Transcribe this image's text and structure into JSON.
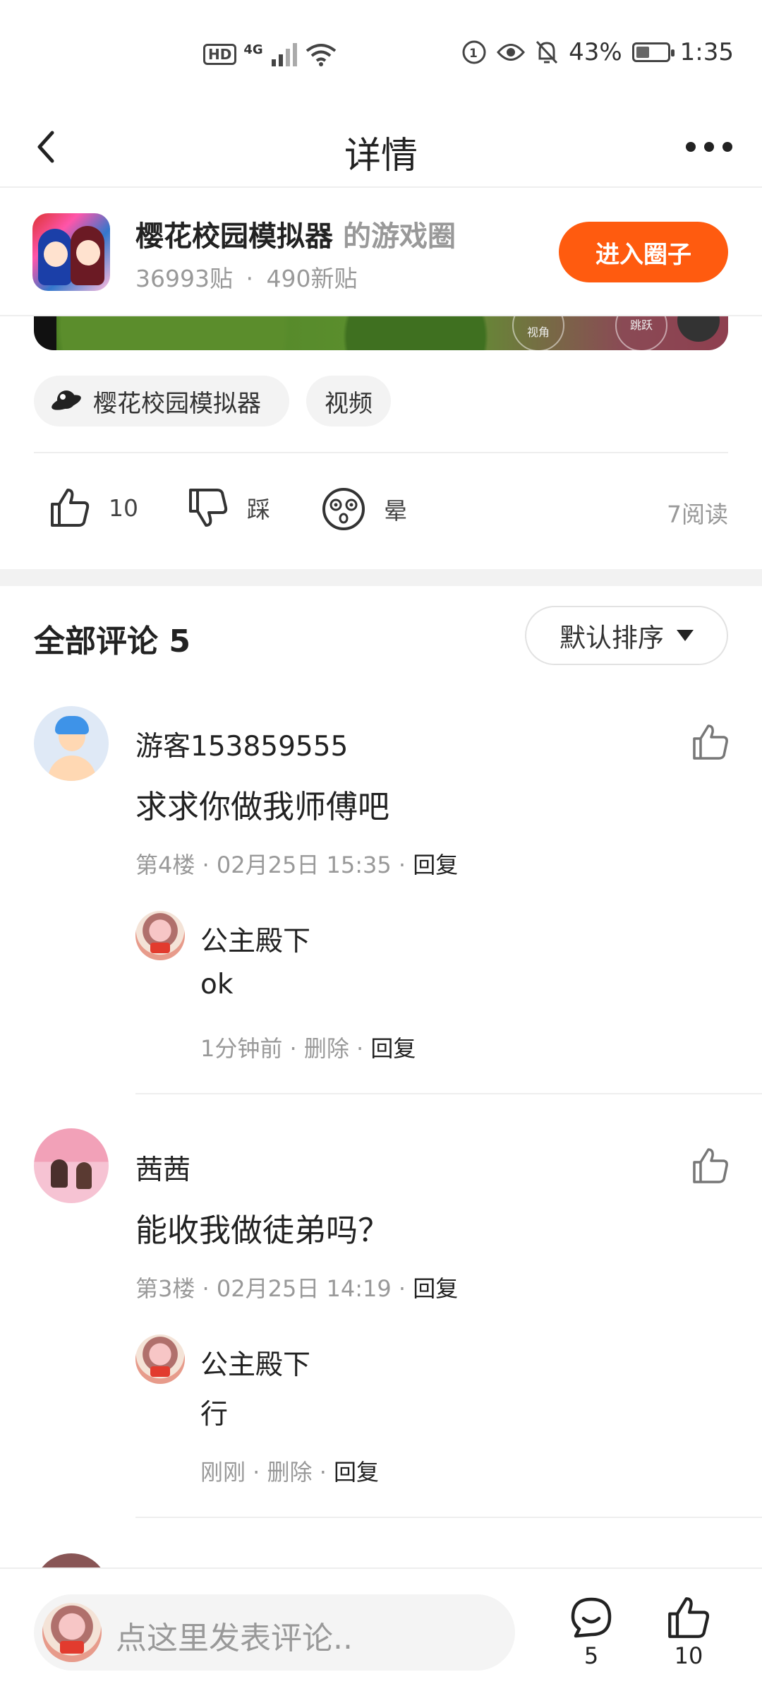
{
  "status_bar": {
    "network": "4G",
    "hd": "HD",
    "battery_percent": "43%",
    "battery_level": 0.43,
    "time": "1:35"
  },
  "header": {
    "title": "详情"
  },
  "circle": {
    "game_name": "樱花校园模拟器",
    "suffix": "的游戏圈",
    "posts": "36993贴",
    "separator": "·",
    "new_posts": "490新贴",
    "enter_label": "进入圈子"
  },
  "video_controls": {
    "c1": "视角",
    "c2": "跳跃"
  },
  "tags": [
    {
      "label": "樱花校园模拟器",
      "icon": "game-planet-icon"
    },
    {
      "label": "视频"
    }
  ],
  "actions": {
    "like_count": "10",
    "dislike_label": "踩",
    "dizzy_label": "晕",
    "read_count": "7阅读"
  },
  "comments": {
    "title": "全部评论 5",
    "sort_label": "默认排序",
    "items": [
      {
        "user": "游客153859555",
        "text": "求求你做我师傅吧",
        "meta": "第4楼 · 02月25日 15:35 · ",
        "reply_label": "回复",
        "reply": {
          "user": "公主殿下",
          "text": "ok",
          "meta": "1分钟前 · 删除 · ",
          "reply_label": "回复"
        }
      },
      {
        "user": "茜茜",
        "text": "能收我做徒弟吗？",
        "meta": "第3楼 · 02月25日 14:19 · ",
        "reply_label": "回复",
        "reply": {
          "user": "公主殿下",
          "text": "行",
          "meta": "刚刚 · 删除 · ",
          "reply_label": "回复"
        }
      }
    ]
  },
  "bottom_bar": {
    "placeholder": "点这里发表评论..",
    "comment_count": "5",
    "like_count": "10"
  }
}
